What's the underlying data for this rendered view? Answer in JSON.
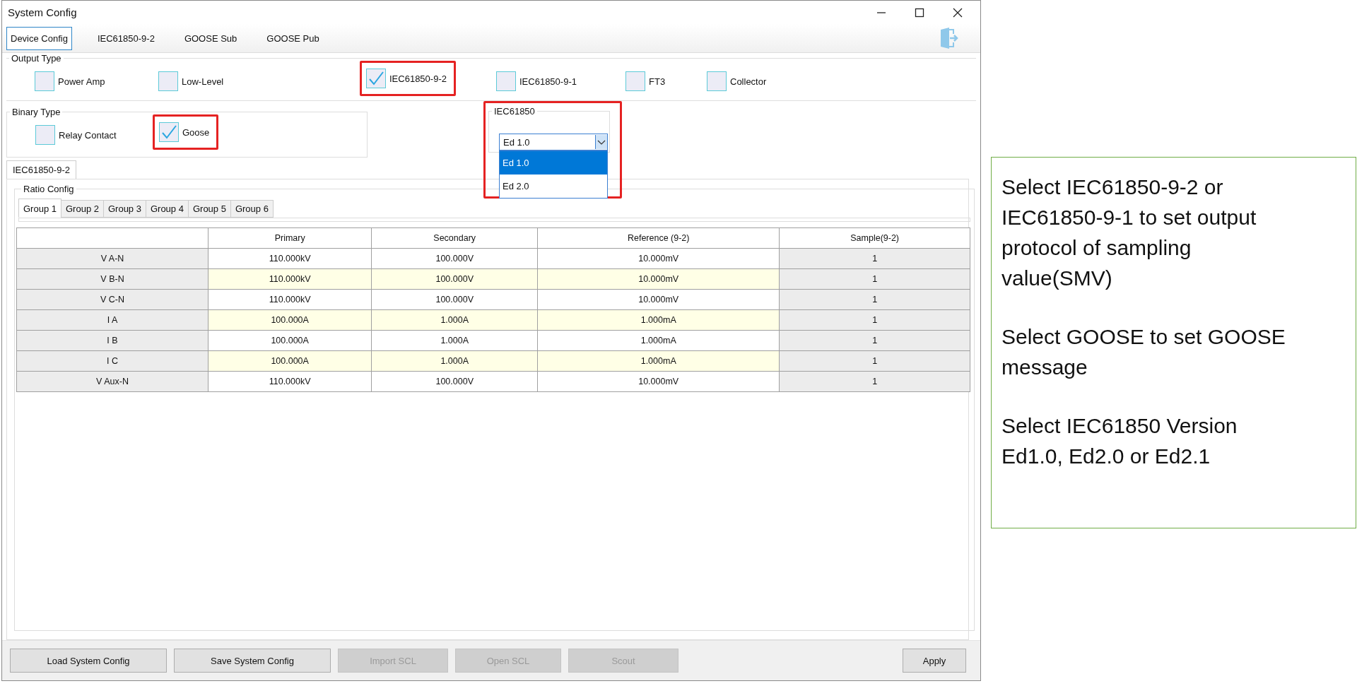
{
  "window": {
    "title": "System Config"
  },
  "tabs": [
    {
      "label": "Device Config",
      "selected": true
    },
    {
      "label": "IEC61850-9-2",
      "selected": false
    },
    {
      "label": "GOOSE Sub",
      "selected": false
    },
    {
      "label": "GOOSE Pub",
      "selected": false
    }
  ],
  "output_type": {
    "title": "Output Type",
    "options": [
      {
        "label": "Power Amp",
        "checked": false,
        "highlighted": false
      },
      {
        "label": "Low-Level",
        "checked": false,
        "highlighted": false
      },
      {
        "label": "IEC61850-9-2",
        "checked": true,
        "highlighted": true
      },
      {
        "label": "IEC61850-9-1",
        "checked": false,
        "highlighted": false
      },
      {
        "label": "FT3",
        "checked": false,
        "highlighted": false
      },
      {
        "label": "Collector",
        "checked": false,
        "highlighted": false
      }
    ]
  },
  "binary_type": {
    "title": "Binary Type",
    "options": [
      {
        "label": "Relay Contact",
        "checked": false,
        "highlighted": false
      },
      {
        "label": "Goose",
        "checked": true,
        "highlighted": true
      }
    ]
  },
  "iec61850": {
    "title": "IEC61850",
    "highlighted": true,
    "value": "Ed 1.0",
    "options": [
      {
        "label": "Ed 1.0",
        "selected": true
      },
      {
        "label": "Ed 2.0",
        "selected": false
      }
    ]
  },
  "inner_tabs": [
    {
      "label": "IEC61850-9-2",
      "selected": true
    }
  ],
  "ratio_config": {
    "title": "Ratio Config",
    "group_tabs": [
      {
        "label": "Group 1",
        "selected": true
      },
      {
        "label": "Group 2",
        "selected": false
      },
      {
        "label": "Group 3",
        "selected": false
      },
      {
        "label": "Group 4",
        "selected": false
      },
      {
        "label": "Group 5",
        "selected": false
      },
      {
        "label": "Group 6",
        "selected": false
      }
    ],
    "table": {
      "columns": [
        "Primary",
        "Secondary",
        "Reference (9-2)",
        "Sample(9-2)"
      ],
      "rows": [
        {
          "name": "V A-N",
          "cells": [
            "110.000kV",
            "100.000V",
            "10.000mV",
            "1"
          ]
        },
        {
          "name": "V B-N",
          "cells": [
            "110.000kV",
            "100.000V",
            "10.000mV",
            "1"
          ]
        },
        {
          "name": "V C-N",
          "cells": [
            "110.000kV",
            "100.000V",
            "10.000mV",
            "1"
          ]
        },
        {
          "name": "I A",
          "cells": [
            "100.000A",
            "1.000A",
            "1.000mA",
            "1"
          ]
        },
        {
          "name": "I B",
          "cells": [
            "100.000A",
            "1.000A",
            "1.000mA",
            "1"
          ]
        },
        {
          "name": "I C",
          "cells": [
            "100.000A",
            "1.000A",
            "1.000mA",
            "1"
          ]
        },
        {
          "name": "V Aux-N",
          "cells": [
            "110.000kV",
            "100.000V",
            "10.000mV",
            "1"
          ]
        }
      ]
    }
  },
  "buttons": [
    {
      "label": "Load System Config",
      "disabled": false
    },
    {
      "label": "Save System Config",
      "disabled": false
    },
    {
      "label": "Import SCL",
      "disabled": true
    },
    {
      "label": "Open SCL",
      "disabled": true
    },
    {
      "label": "Scout",
      "disabled": true
    }
  ],
  "apply_button": {
    "label": "Apply",
    "disabled": false
  },
  "annotation": [
    "Select IEC61850-9-2 or IEC61850-9-1 to set output protocol of sampling value(SMV)",
    "Select GOOSE to set GOOSE message",
    "Select IEC61850 Version Ed1.0, Ed2.0 or Ed2.1"
  ]
}
